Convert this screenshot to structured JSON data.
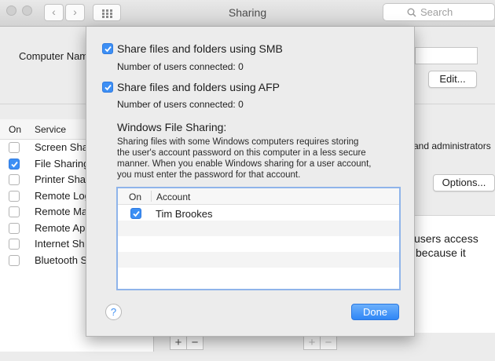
{
  "window": {
    "title": "Sharing",
    "search_placeholder": "Search"
  },
  "background": {
    "computer_name_label": "Computer Nam",
    "edit_button": "Edit...",
    "list_header_on": "On",
    "list_header_service": "Service",
    "services": [
      {
        "name": "Screen Sha",
        "checked": false
      },
      {
        "name": "File Sharing",
        "checked": true
      },
      {
        "name": "Printer Sha",
        "checked": false
      },
      {
        "name": "Remote Log",
        "checked": false
      },
      {
        "name": "Remote Ma",
        "checked": false
      },
      {
        "name": "Remote Ap",
        "checked": false
      },
      {
        "name": "Internet Sh",
        "checked": false
      },
      {
        "name": "Bluetooth S",
        "checked": false
      }
    ],
    "admins_text": "and administrators",
    "options_button": "Options...",
    "users_access_line1": "users access",
    "users_access_line2": "because it",
    "add_symbol": "+",
    "remove_symbol": "−"
  },
  "sheet": {
    "smb": {
      "label": "Share files and folders using SMB",
      "checked": true,
      "users_connected": "Number of users connected: 0"
    },
    "afp": {
      "label": "Share files and folders using AFP",
      "checked": true,
      "users_connected": "Number of users connected: 0"
    },
    "windows_heading": "Windows File Sharing:",
    "windows_text_lines": [
      "Sharing files with some Windows computers requires storing",
      "the user's account password on this computer in a less secure",
      "manner.  When you enable Windows sharing for a user account,",
      "you must enter the password for that account."
    ],
    "table": {
      "col_on": "On",
      "col_account": "Account",
      "rows": [
        {
          "account": "Tim Brookes",
          "checked": true
        }
      ]
    },
    "help_label": "?",
    "done_label": "Done"
  },
  "colors": {
    "accent": "#3d8ff4",
    "table_focus": "#8fb4ea"
  }
}
